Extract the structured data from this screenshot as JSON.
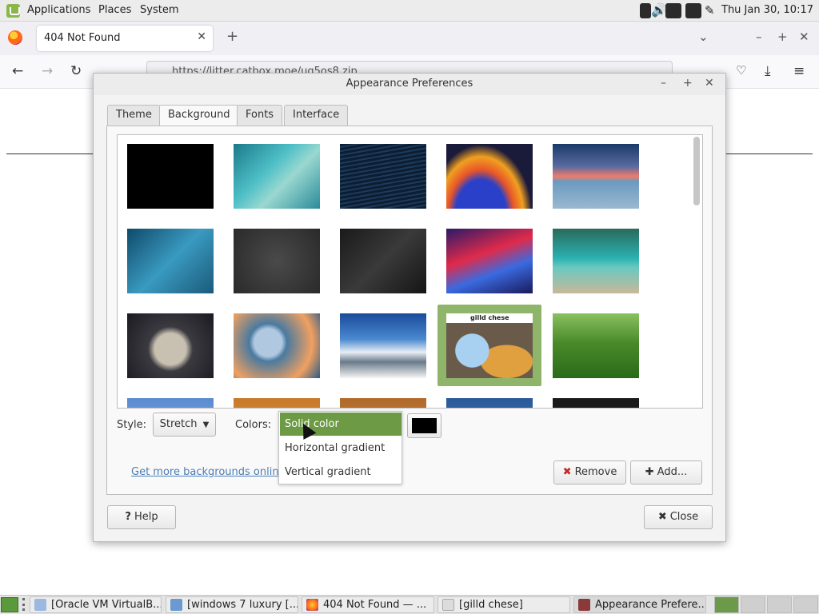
{
  "top_panel": {
    "menus": [
      "Applications",
      "Places",
      "System"
    ],
    "clock": "Thu Jan 30, 10:17",
    "tray_icons": [
      "network-icon",
      "volume-icon",
      "shield-icon",
      "update-icon",
      "brush-icon"
    ]
  },
  "browser": {
    "tab_title": "404 Not Found",
    "url": "https://litter.catbox.moe/uq5os8.zip"
  },
  "dialog": {
    "title": "Appearance Preferences",
    "tabs": [
      "Theme",
      "Background",
      "Fonts",
      "Interface"
    ],
    "active_tab": "Background",
    "style_label": "Style:",
    "style_value": "Stretch",
    "colors_label": "Colors:",
    "color_options": [
      "Solid color",
      "Horizontal gradient",
      "Vertical gradient"
    ],
    "selected_color_option": "Solid color",
    "swatch_color": "#000000",
    "more_link": "Get more backgrounds online",
    "remove_label": "Remove",
    "add_label": "Add...",
    "help_label": "Help",
    "close_label": "Close",
    "selected_thumb_text": "gilld chese"
  },
  "taskbar": {
    "items": [
      "[Oracle VM VirtualB...",
      "[windows 7 luxury [...",
      "404 Not Found — ...",
      "[gilld chese]",
      "Appearance Prefere..."
    ]
  },
  "colors": {
    "accent": "#6d9a45",
    "selection_bg": "#8fb56b",
    "link": "#4a7db5"
  }
}
